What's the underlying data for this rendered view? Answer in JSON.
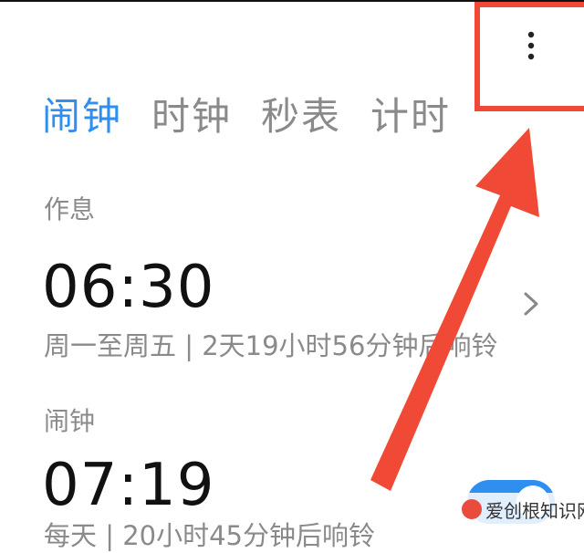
{
  "tabs": [
    {
      "label": "闹钟",
      "active": true
    },
    {
      "label": "时钟",
      "active": false
    },
    {
      "label": "秒表",
      "active": false
    },
    {
      "label": "计时",
      "active": false
    }
  ],
  "sections": [
    {
      "label": "作息",
      "alarm_time": "06:30",
      "description": "周一至周五 | 2天19小时56分钟后响铃"
    },
    {
      "label": "闹钟",
      "alarm_time": "07:19",
      "description": "每天 | 20小时45分钟后响铃"
    }
  ],
  "menu": {
    "icon": "more-vertical-icon"
  },
  "colors": {
    "accent": "#2f8ff0",
    "annotation": "#f04a36"
  },
  "watermark": {
    "text": "爱创根知识网"
  }
}
